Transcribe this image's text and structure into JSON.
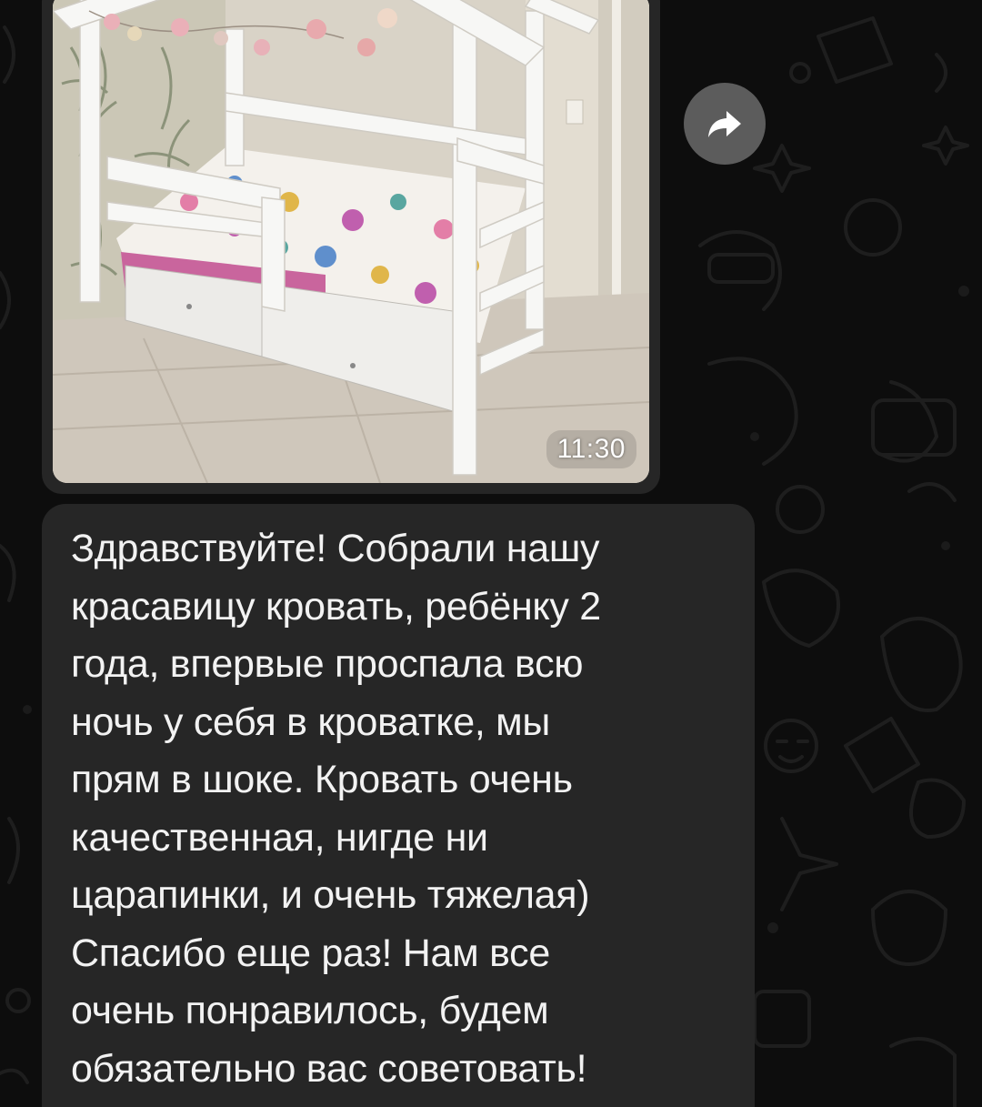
{
  "chat": {
    "photo_message": {
      "time": "11:30",
      "forward_icon": "forward-arrow-icon"
    },
    "text_message": {
      "lines": [
        "Здравствуйте! Собрали нашу",
        "красавицу кровать, ребёнку 2",
        "года, впервые проспала всю",
        "ночь у себя в кроватке, мы",
        "прям в шоке. Кровать очень",
        "качественная, нигде ни",
        "царапинки, и очень тяжелая)",
        "Спасибо еще раз! Нам все",
        "очень понравилось, будем",
        "обязательно вас советовать!"
      ]
    }
  },
  "colors": {
    "background": "#0d0d0d",
    "bubble": "#262626",
    "text": "#f2f2f2",
    "forward_button": "#5c5c5c"
  }
}
